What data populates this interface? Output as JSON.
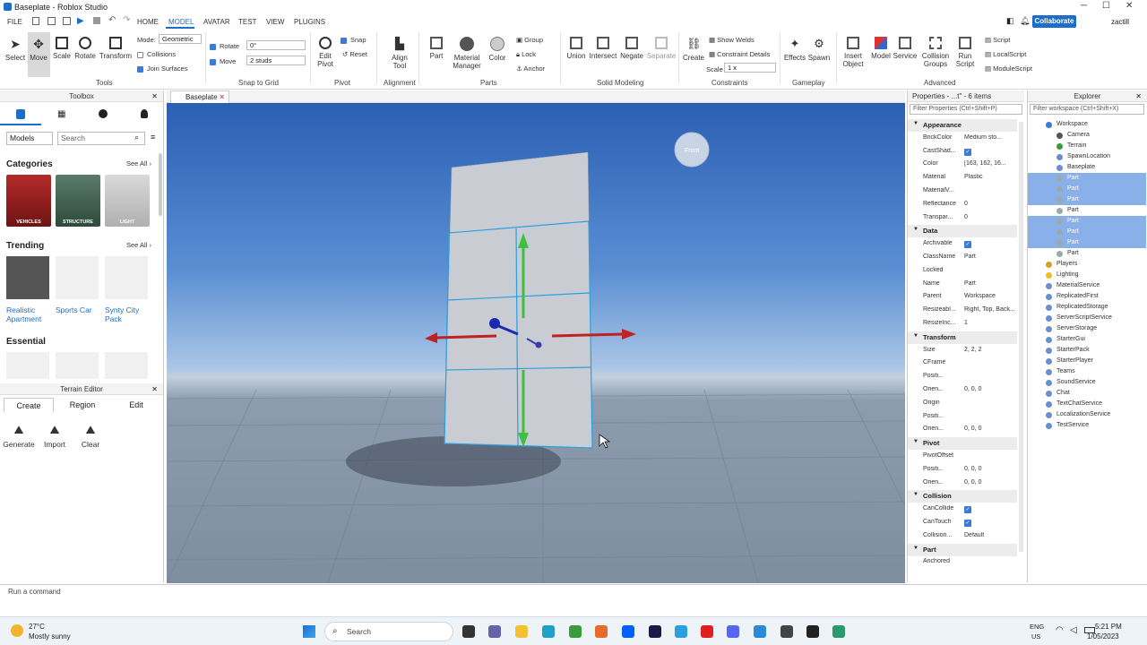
{
  "window": {
    "title": "Baseplate - Roblox Studio",
    "user": "zactill",
    "collaborate": "Collaborate"
  },
  "menu": {
    "file": "FILE",
    "tabs": [
      "HOME",
      "MODEL",
      "AVATAR",
      "TEST",
      "VIEW",
      "PLUGINS"
    ],
    "active": "MODEL"
  },
  "ribbon": {
    "tools": {
      "select": "Select",
      "move": "Move",
      "scale": "Scale",
      "rotate": "Rotate",
      "transform": "Transform",
      "label": "Tools"
    },
    "mode": {
      "label": "Mode:",
      "value": "Geometric",
      "collisions": "Collisions",
      "join_surfaces": "Join Surfaces"
    },
    "snap": {
      "rotate": "Rotate",
      "rotate_val": "0°",
      "move": "Move",
      "move_val": "2 studs",
      "label": "Snap to Grid"
    },
    "pivot": {
      "edit": "Edit Pivot",
      "snap": "Snap",
      "reset": "Reset",
      "label": "Pivot"
    },
    "alignment": {
      "align": "Align Tool",
      "label": "Alignment"
    },
    "parts": {
      "part": "Part",
      "material": "Material Manager",
      "color": "Color",
      "group": "Group",
      "lock": "Lock",
      "anchor": "Anchor",
      "label": "Parts"
    },
    "solid": {
      "union": "Union",
      "intersect": "Intersect",
      "negate": "Negate",
      "separate": "Separate",
      "label": "Solid Modeling"
    },
    "constraints": {
      "create": "Create",
      "show_welds": "Show Welds",
      "details": "Constraint Details",
      "scale": "Scale",
      "scale_val": "1 x",
      "label": "Constraints"
    },
    "gameplay": {
      "effects": "Effects",
      "spawn": "Spawn",
      "label": "Gameplay"
    },
    "advanced": {
      "insert": "Insert Object",
      "model": "Model",
      "service": "Service",
      "collision": "Collision Groups",
      "run": "Run Script",
      "script": "Script",
      "localscript": "LocalScript",
      "modulescript": "ModuleScript",
      "label": "Advanced"
    }
  },
  "toolbox": {
    "title": "Toolbox",
    "dropdown": "Models",
    "search_placeholder": "Search",
    "categories_title": "Categories",
    "see_all": "See All",
    "categories": [
      "VEHICLES",
      "STRUCTURE",
      "LIGHT"
    ],
    "trending_title": "Trending",
    "trending": [
      "Realistic Apartment",
      "Sports Car",
      "Synty City Pack"
    ],
    "essential_title": "Essential"
  },
  "terrain": {
    "title": "Terrain Editor",
    "tabs": [
      "Create",
      "Region",
      "Edit"
    ],
    "tools": [
      "Generate",
      "Import",
      "Clear"
    ]
  },
  "doc_tab": "Baseplate",
  "viewport": {
    "cube_label": "Front"
  },
  "properties": {
    "title": "Properties - ...t\" - 6 items",
    "filter": "Filter Properties (Ctrl+Shift+P)",
    "rows": [
      {
        "cat": "Appearance"
      },
      {
        "k": "BrickColor",
        "v": "Medium sto..."
      },
      {
        "k": "CastShad...",
        "v": "✓"
      },
      {
        "k": "Color",
        "v": "[163, 162, 16..."
      },
      {
        "k": "Material",
        "v": "Plastic"
      },
      {
        "k": "MaterialV...",
        "v": ""
      },
      {
        "k": "Reflectance",
        "v": "0"
      },
      {
        "k": "Transpar...",
        "v": "0"
      },
      {
        "cat": "Data"
      },
      {
        "k": "Archivable",
        "v": "✓"
      },
      {
        "k": "ClassName",
        "v": "Part"
      },
      {
        "k": "Locked",
        "v": ""
      },
      {
        "k": "Name",
        "v": "Part"
      },
      {
        "k": "Parent",
        "v": "Workspace"
      },
      {
        "k": "ResizeabI...",
        "v": "Right, Top, Back..."
      },
      {
        "k": "ResizeInc...",
        "v": "1"
      },
      {
        "cat": "Transform"
      },
      {
        "k": "Size",
        "v": "2, 2, 2"
      },
      {
        "k": "CFrame",
        "v": ""
      },
      {
        "k": "Positi...",
        "v": ""
      },
      {
        "k": "Orien...",
        "v": "0, 0, 0"
      },
      {
        "k": "Origin",
        "v": ""
      },
      {
        "k": "Positi...",
        "v": ""
      },
      {
        "k": "Orien...",
        "v": "0, 0, 0"
      },
      {
        "cat": "Pivot"
      },
      {
        "k": "PivotOffset",
        "v": ""
      },
      {
        "k": "Positi...",
        "v": "0, 0, 0"
      },
      {
        "k": "Orien...",
        "v": "0, 0, 0"
      },
      {
        "cat": "Collision"
      },
      {
        "k": "CanCollide",
        "v": "✓"
      },
      {
        "k": "CanTouch",
        "v": "✓"
      },
      {
        "k": "Collision...",
        "v": "Default"
      },
      {
        "cat": "Part"
      },
      {
        "k": "Anchored",
        "v": ""
      }
    ]
  },
  "explorer": {
    "title": "Explorer",
    "filter": "Filter workspace (Ctrl+Shift+X)",
    "items": [
      {
        "n": "Workspace",
        "sel": false
      },
      {
        "n": "Camera",
        "sel": false
      },
      {
        "n": "Terrain",
        "sel": false
      },
      {
        "n": "SpawnLocation",
        "sel": false
      },
      {
        "n": "Baseplate",
        "sel": false
      },
      {
        "n": "Part",
        "sel": true
      },
      {
        "n": "Part",
        "sel": true
      },
      {
        "n": "Part",
        "sel": true
      },
      {
        "n": "Part",
        "sel": false
      },
      {
        "n": "Part",
        "sel": true
      },
      {
        "n": "Part",
        "sel": true
      },
      {
        "n": "Part",
        "sel": true
      },
      {
        "n": "Part",
        "sel": false
      },
      {
        "n": "Players",
        "sel": false
      },
      {
        "n": "Lighting",
        "sel": false
      },
      {
        "n": "MaterialService",
        "sel": false
      },
      {
        "n": "ReplicatedFirst",
        "sel": false
      },
      {
        "n": "ReplicatedStorage",
        "sel": false
      },
      {
        "n": "ServerScriptService",
        "sel": false
      },
      {
        "n": "ServerStorage",
        "sel": false
      },
      {
        "n": "StarterGui",
        "sel": false
      },
      {
        "n": "StarterPack",
        "sel": false
      },
      {
        "n": "StarterPlayer",
        "sel": false
      },
      {
        "n": "Teams",
        "sel": false
      },
      {
        "n": "SoundService",
        "sel": false
      },
      {
        "n": "Chat",
        "sel": false
      },
      {
        "n": "TextChatService",
        "sel": false
      },
      {
        "n": "LocalizationService",
        "sel": false
      },
      {
        "n": "TestService",
        "sel": false
      }
    ]
  },
  "command": {
    "placeholder": "Run a command"
  },
  "taskbar": {
    "temp": "27°C",
    "weather": "Mostly sunny",
    "search": "Search",
    "lang1": "ENG",
    "lang2": "US",
    "time": "5:21 PM",
    "date": "1/05/2023"
  }
}
